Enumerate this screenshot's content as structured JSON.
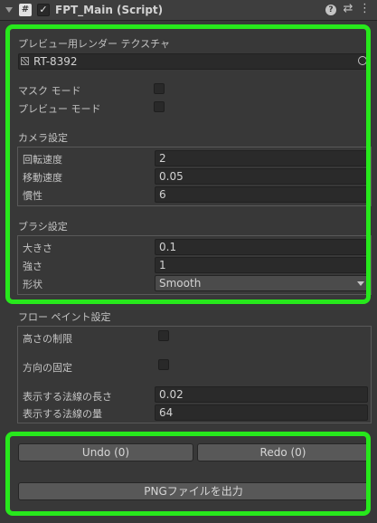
{
  "header": {
    "title": "FPT_Main (Script)",
    "enabled": true
  },
  "preview": {
    "label": "プレビュー用レンダー テクスチャ",
    "texture_value": "RT-8392",
    "mask_mode_label": "マスク モード",
    "mask_mode_checked": false,
    "preview_mode_label": "プレビュー モード",
    "preview_mode_checked": false
  },
  "camera": {
    "title": "カメラ設定",
    "rotation_label": "回転速度",
    "rotation_value": "2",
    "move_label": "移動速度",
    "move_value": "0.05",
    "inertia_label": "慣性",
    "inertia_value": "6"
  },
  "brush": {
    "title": "ブラシ設定",
    "size_label": "大きさ",
    "size_value": "0.1",
    "strength_label": "強さ",
    "strength_value": "1",
    "shape_label": "形状",
    "shape_value": "Smooth"
  },
  "flow": {
    "title": "フロー ペイント設定",
    "height_limit_label": "高さの制限",
    "height_limit_checked": false,
    "direction_lock_label": "方向の固定",
    "direction_lock_checked": false,
    "normal_length_label": "表示する法線の長さ",
    "normal_length_value": "0.02",
    "normal_count_label": "表示する法線の量",
    "normal_count_value": "64"
  },
  "actions": {
    "undo_label": "Undo (0)",
    "redo_label": "Redo (0)",
    "export_label": "PNGファイルを出力"
  },
  "colors": {
    "highlight": "#27e81c",
    "background": "#383838"
  }
}
